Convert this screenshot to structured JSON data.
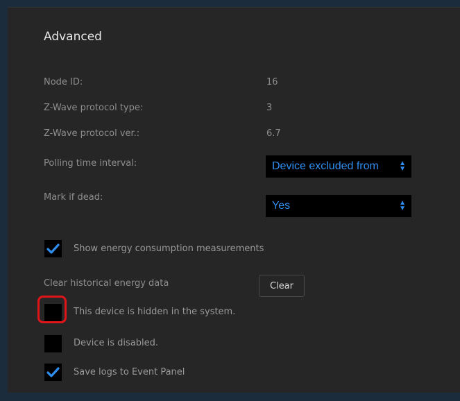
{
  "section_title": "Advanced",
  "info": {
    "node_id_label": "Node ID:",
    "node_id_value": "16",
    "protocol_type_label": "Z-Wave protocol type:",
    "protocol_type_value": "3",
    "protocol_ver_label": "Z-Wave protocol ver.:",
    "protocol_ver_value": "6.7"
  },
  "polling": {
    "label": "Polling time interval:",
    "selected": "Device excluded from"
  },
  "dead": {
    "label": "Mark if dead:",
    "selected": "Yes"
  },
  "checkboxes": {
    "energy": {
      "label": "Show energy consumption measurements",
      "checked": true
    },
    "hidden": {
      "label": "This device is hidden in the system.",
      "checked": false
    },
    "disabled": {
      "label": "Device is disabled.",
      "checked": false
    },
    "logs": {
      "label": "Save logs to Event Panel",
      "checked": true
    }
  },
  "clear_history": {
    "label": "Clear historical energy data",
    "button_label": "Clear"
  },
  "colors": {
    "accent": "#2f8ff0",
    "highlight": "#e0151a",
    "panel": "#262626",
    "background": "#1b2c3c"
  }
}
